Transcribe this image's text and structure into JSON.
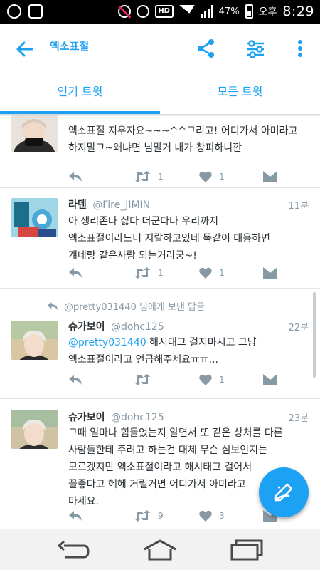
{
  "status_bar": {
    "battery_percent": "47%",
    "ampm": "오후",
    "time": "8:29",
    "hd_label": "HD",
    "icons": [
      "notification-icon",
      "image-icon",
      "mute-icon",
      "alarm-icon",
      "hd-icon",
      "wifi-icon",
      "signal-icon",
      "battery-icon"
    ]
  },
  "header": {
    "search_query": "엑소표절",
    "icons": {
      "back": "arrow-left-icon",
      "share": "share-icon",
      "filter": "sliders-icon",
      "more": "more-vertical-icon"
    }
  },
  "tabs": [
    {
      "label": "인기 트윗",
      "active": true
    },
    {
      "label": "모든 트윗",
      "active": false
    }
  ],
  "tweets": [
    {
      "name": "",
      "handle": "",
      "time": "",
      "lines": [
        "엑소표절 지우자요~~~^^그리고! 어디가서 아미라고",
        "하지말그~왜냐면 님말거 내가 창피하니깐"
      ],
      "retweets": "1",
      "likes": "1"
    },
    {
      "name": "라덴",
      "handle": "@Fire_JIMIN",
      "time": "11분",
      "lines": [
        "아 생리존나 싫다 더군다나 우리까지",
        "엑소표절이라느니 지랄하고있네 똑같이 대응하면",
        "걔네랑 같은사람 되는거라궁~!"
      ],
      "retweets": "1",
      "likes": "1"
    },
    {
      "reply_to_handle": "@pretty031440",
      "reply_to_suffix": "님에게 보낸 답글",
      "name": "슈가보이",
      "handle": "@dohc125",
      "time": "22분",
      "mention": "@pretty031440",
      "line1_rest": " 해시태그 걸지마시고 그냥",
      "line2": "엑소표절이라고 언급해주세요ㅠㅠ...",
      "retweets": "",
      "likes": "1"
    },
    {
      "name": "슈가보이",
      "handle": "@dohc125",
      "time": "23분",
      "lines": [
        "그때 얼마나 힘들었는지 알면서 또 같은 상처를 다른",
        "사람들한테 주려고 하는건 대체 무슨 심보인지는",
        "모르겠지만 엑소표절이라고 해시태그 걸어서",
        "꼴좋다고 헤헤 거릴거면 어디가서 아미라고",
        "마세요."
      ],
      "retweets": "9",
      "likes": "3"
    }
  ],
  "action_icons": [
    "reply-icon",
    "retweet-icon",
    "heart-icon",
    "message-icon"
  ],
  "fab_icon": "compose-tweet-icon",
  "nav_icons": [
    "nav-back-icon",
    "nav-home-icon",
    "nav-recent-apps-icon"
  ]
}
